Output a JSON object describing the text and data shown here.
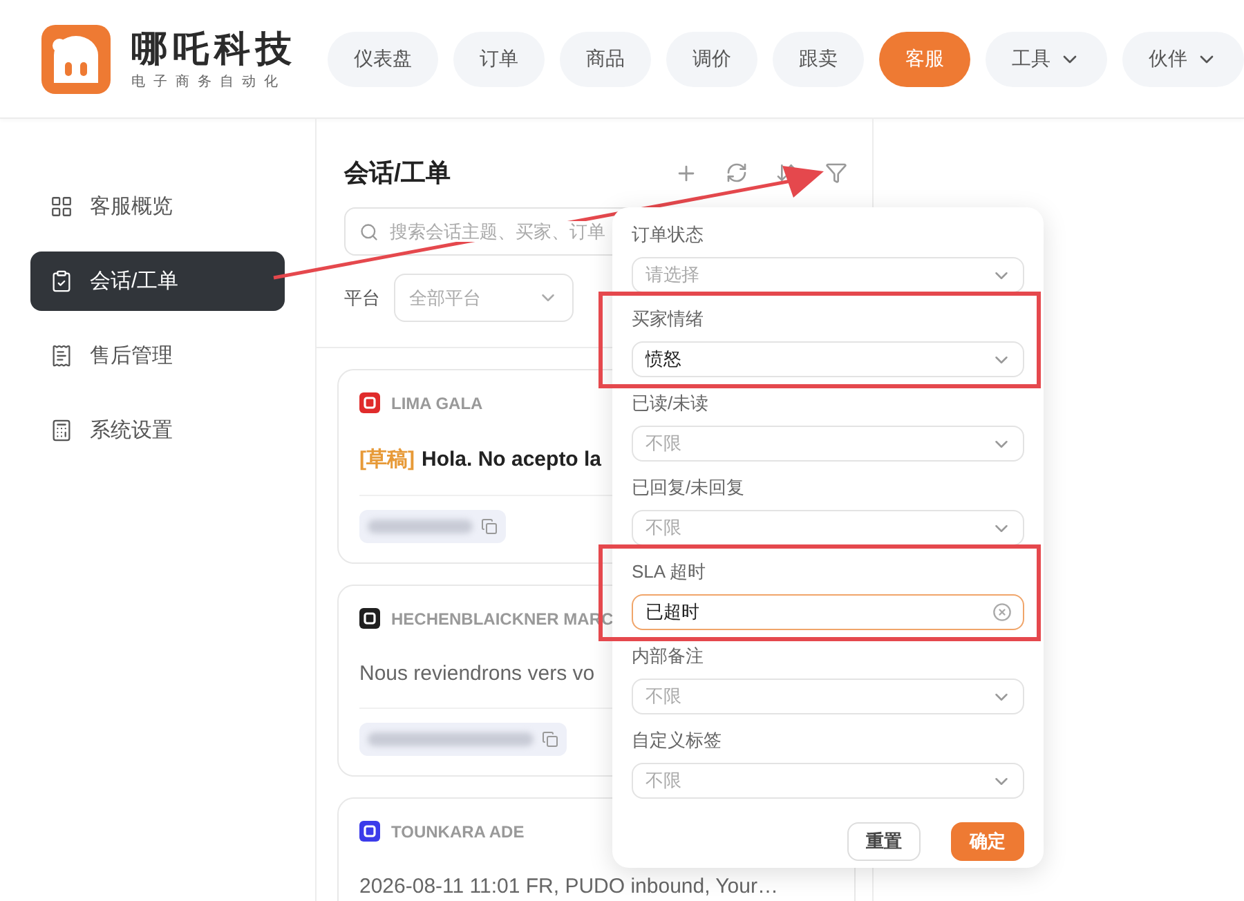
{
  "brand": {
    "name": "哪吒科技",
    "tagline": "电子商务自动化"
  },
  "nav": [
    {
      "label": "仪表盘",
      "selected": false,
      "has_menu": false
    },
    {
      "label": "订单",
      "selected": false,
      "has_menu": false
    },
    {
      "label": "商品",
      "selected": false,
      "has_menu": false
    },
    {
      "label": "调价",
      "selected": false,
      "has_menu": false
    },
    {
      "label": "跟卖",
      "selected": false,
      "has_menu": false
    },
    {
      "label": "客服",
      "selected": true,
      "has_menu": false
    },
    {
      "label": "工具",
      "selected": false,
      "has_menu": true
    },
    {
      "label": "伙伴",
      "selected": false,
      "has_menu": true
    }
  ],
  "sidebar": {
    "items": [
      {
        "label": "客服概览",
        "selected": false
      },
      {
        "label": "会话/工单",
        "selected": true
      },
      {
        "label": "售后管理",
        "selected": false
      },
      {
        "label": "系统设置",
        "selected": false
      }
    ]
  },
  "panel": {
    "title": "会话/工单",
    "search": {
      "placeholder": "搜索会话主题、买家、订单"
    },
    "platform_filter": {
      "label": "平台",
      "placeholder": "全部平台"
    }
  },
  "conversations": [
    {
      "shop": "LIMA GALA",
      "color": "#e02b2b",
      "draft_tag": "[草稿]",
      "message": "Hola. No acepto la"
    },
    {
      "shop": "HECHENBLAICKNER MARC",
      "color": "#1f1f1f",
      "message": "Nous reviendrons vers vo"
    },
    {
      "shop": "TOUNKARA ADE",
      "color": "#3b3bea",
      "message": "2026-08-11 11:01 FR, PUDO inbound, Your…"
    }
  ],
  "filter_popover": {
    "fields": [
      {
        "label": "订单状态",
        "placeholder": "请选择",
        "focused": false,
        "highlighted": false
      },
      {
        "label": "买家情绪",
        "value": "愤怒",
        "focused": false,
        "highlighted": true
      },
      {
        "label": "已读/未读",
        "placeholder": "不限",
        "focused": false,
        "highlighted": false
      },
      {
        "label": "已回复/未回复",
        "placeholder": "不限",
        "focused": false,
        "highlighted": false
      },
      {
        "label": "SLA 超时",
        "value": "已超时",
        "focused": true,
        "highlighted": true
      },
      {
        "label": "内部备注",
        "placeholder": "不限",
        "focused": false,
        "highlighted": false
      },
      {
        "label": "自定义标签",
        "placeholder": "不限",
        "focused": false,
        "highlighted": false
      }
    ],
    "reset_label": "重置",
    "confirm_label": "确定"
  },
  "pointer_arrow": true
}
